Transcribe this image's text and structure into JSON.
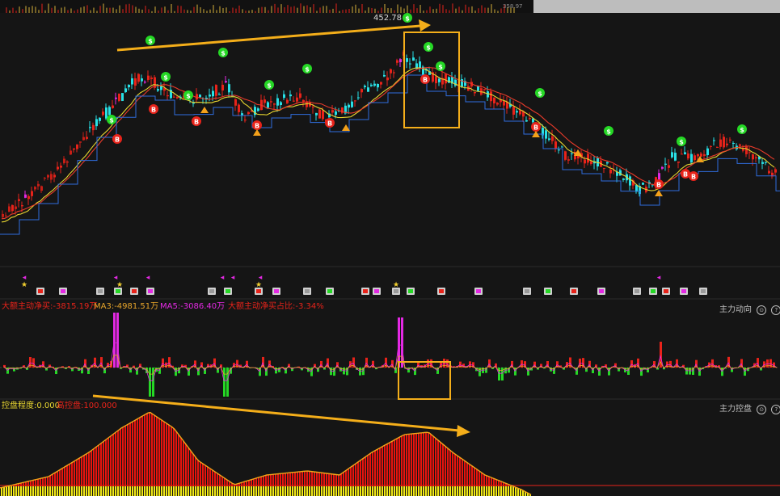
{
  "colors": {
    "bg": "#151515",
    "up": "#e8231a",
    "down": "#28e0e6",
    "magenta": "#e329e3",
    "green": "#25d825",
    "ma_yellow": "#e8d630",
    "ma_red": "#e83a2a",
    "ma_blue": "#2f6dde",
    "arrow": "#f4ae1a",
    "box": "#f4ae1a",
    "fill_red": "#e8140e",
    "fill_yellow": "#f2ea16"
  },
  "top_strip": {
    "value": "358.97"
  },
  "price_panel": {
    "high_label": "452.78",
    "signal_marks": [
      "$",
      "B",
      "S"
    ]
  },
  "indicator_panel": {
    "items": [
      {
        "key": "main",
        "text": "大额主动净买:-3815.19万",
        "color": "#e8231a"
      },
      {
        "key": "ma3",
        "text": "MA3:-4981.51万",
        "color": "#e8a52a"
      },
      {
        "key": "ma5",
        "text": "MA5:-3086.40万",
        "color": "#e329e3"
      },
      {
        "key": "ratio",
        "text": "大额主动净买占比:-3.34%",
        "color": "#e8231a"
      }
    ],
    "title": "主力动向"
  },
  "control_panel": {
    "items": [
      {
        "key": "degree",
        "text": "控盘程度:0.000",
        "color": "#e8d630"
      },
      {
        "key": "high",
        "text": "高控盘:100.000",
        "color": "#e8231a"
      }
    ],
    "title": "主力控盘"
  },
  "controls": {
    "circle": "⊙",
    "help": "?",
    "close": "×"
  },
  "chart_data": [
    {
      "type": "candlestick",
      "title": "",
      "annotations": [
        "452.78"
      ],
      "series": [
        {
          "name": "MA-yellow",
          "role": "moving-average"
        },
        {
          "name": "MA-red",
          "role": "moving-average"
        },
        {
          "name": "step-line",
          "role": "support-resistance"
        }
      ]
    },
    {
      "type": "bar",
      "legend": [
        "大额主动净买:-3815.19万",
        "MA3:-4981.51万",
        "MA5:-3086.40万",
        "大额主动净买占比:-3.34%"
      ],
      "last_value": -3815.19
    },
    {
      "type": "area",
      "legend": [
        "控盘程度:0.000",
        "高控盘:100.000"
      ],
      "last_value": 0.0
    }
  ]
}
